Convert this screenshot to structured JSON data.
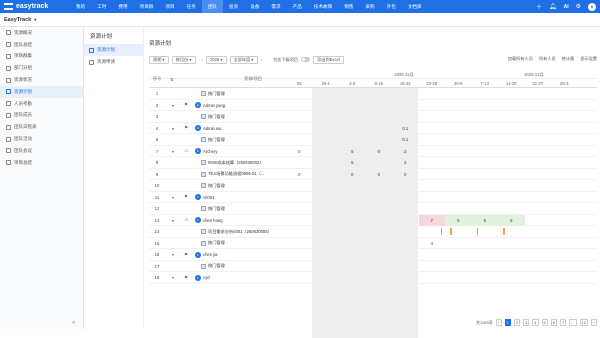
{
  "app": {
    "name": "easytrack"
  },
  "nav": [
    "我的",
    "工时",
    "费用",
    "项目群",
    "项目",
    "任务",
    "团队",
    "投资",
    "设备",
    "需求",
    "产品",
    "技术故障",
    "销售",
    "采购",
    "外包",
    "文档库"
  ],
  "nav_active_index": 6,
  "subbar_title": "EasyTrack",
  "sidebar": [
    {
      "label": "资源概况",
      "active": false
    },
    {
      "label": "团队总结",
      "active": false
    },
    {
      "label": "项目群集",
      "active": false
    },
    {
      "label": "部门分组",
      "active": false
    },
    {
      "label": "资源状况",
      "active": false
    },
    {
      "label": "资源计划",
      "active": true
    },
    {
      "label": "人员考勤",
      "active": false
    },
    {
      "label": "团队成员",
      "active": false
    },
    {
      "label": "团队日程表",
      "active": false
    },
    {
      "label": "团队活动",
      "active": false
    },
    {
      "label": "团队会议",
      "active": false
    },
    {
      "label": "项目总结",
      "active": false
    }
  ],
  "subnav": {
    "heading": "资源计划",
    "items": [
      {
        "label": "资源计划",
        "active": true
      },
      {
        "label": "资源申请",
        "active": false
      }
    ]
  },
  "page_title": "资源计划",
  "toolbar": {
    "unit": "周期",
    "view": "按月份",
    "year": "2025",
    "range": "全部年度",
    "toggle_label": "包含下级项目",
    "export": "导出到Excel",
    "right": [
      "加载所有人员",
      "所有人员",
      "统计量",
      "显示设置"
    ]
  },
  "header": {
    "seq": "序号",
    "name": "资源/项目",
    "months": [
      {
        "label": "2025-11月"
      },
      {
        "label": "2025-12月"
      }
    ],
    "weeks": [
      "25",
      "26-1",
      "2-8",
      "9-15",
      "16-22",
      "23-29",
      "30-6",
      "7-13",
      "14-20",
      "21-27",
      "28-3"
    ]
  },
  "rows": [
    {
      "num": "1",
      "type": "task",
      "name": "按门管理",
      "cells": [
        "",
        "",
        "",
        "",
        "",
        "",
        "",
        "",
        "",
        "",
        ""
      ]
    },
    {
      "num": "2",
      "type": "person",
      "initial": "A",
      "name": "Admin yang",
      "arrow": true,
      "flag": true,
      "cells": [
        "",
        "",
        "",
        "",
        "",
        "",
        "",
        "",
        "",
        "",
        ""
      ]
    },
    {
      "num": "3",
      "type": "task",
      "name": "按门管理",
      "cells": [
        "",
        "",
        "",
        "",
        "",
        "",
        "",
        "",
        "",
        "",
        ""
      ]
    },
    {
      "num": "4",
      "type": "person",
      "initial": "A",
      "name": "Admin wu",
      "arrow": true,
      "flag": true,
      "cells": [
        "",
        "",
        "",
        "",
        "0.1",
        "",
        "",
        "",
        "",
        "",
        ""
      ]
    },
    {
      "num": "6",
      "type": "task",
      "name": "按门管理",
      "cells": [
        "",
        "",
        "",
        "",
        "0.1",
        "",
        "",
        "",
        "",
        "",
        ""
      ]
    },
    {
      "num": "7",
      "type": "person",
      "initial": "A",
      "name": "Archery",
      "arrow": true,
      "warn": true,
      "cells": [
        "0",
        "",
        "5",
        "0",
        "2",
        "",
        "",
        "",
        "",
        "",
        ""
      ]
    },
    {
      "num": "8",
      "type": "task",
      "name": "0530成本核算（250530002）",
      "cells": [
        "",
        "",
        "5",
        "",
        "2",
        "",
        "",
        "",
        "",
        "",
        ""
      ]
    },
    {
      "num": "9",
      "type": "task",
      "name": "TEA场景功能流程0506-01（...",
      "cells": [
        "0",
        "",
        "0",
        "0",
        "0",
        "",
        "",
        "",
        "",
        "",
        ""
      ]
    },
    {
      "num": "10",
      "type": "task",
      "name": "按门管理",
      "cells": [
        "",
        "",
        "",
        "",
        "",
        "",
        "",
        "",
        "",
        "",
        ""
      ]
    },
    {
      "num": "11",
      "type": "person",
      "initial": "c",
      "name": "ch001",
      "arrow": true,
      "flag": true,
      "cells": [
        "",
        "",
        "",
        "",
        "",
        "",
        "",
        "",
        "",
        "",
        ""
      ]
    },
    {
      "num": "12",
      "type": "task",
      "name": "按门管理",
      "cells": [
        "",
        "",
        "",
        "",
        "",
        "",
        "",
        "",
        "",
        "",
        ""
      ]
    },
    {
      "num": "13",
      "type": "person",
      "initial": "c",
      "name": "chen hong",
      "arrow": true,
      "warn": true,
      "cells": [
        "",
        "",
        "",
        "",
        "",
        "7",
        "5",
        "5",
        "5",
        "",
        ""
      ]
    },
    {
      "num": "14",
      "type": "task",
      "name": "项目需求分析0301（250530005）",
      "cells": [
        "",
        "",
        "",
        "",
        "",
        "",
        "",
        "",
        "",
        "",
        ""
      ]
    },
    {
      "num": "15",
      "type": "task",
      "name": "按门管理",
      "cells": [
        "",
        "",
        "",
        "",
        "",
        "4",
        "",
        "",
        "",
        "",
        ""
      ]
    },
    {
      "num": "16",
      "type": "person",
      "initial": "c",
      "name": "chen jia",
      "arrow": true,
      "flag": true,
      "cells": [
        "",
        "",
        "",
        "",
        "",
        "",
        "",
        "",
        "",
        "",
        ""
      ]
    },
    {
      "num": "17",
      "type": "task",
      "name": "按门管理",
      "cells": [
        "",
        "",
        "",
        "",
        "",
        "",
        "",
        "",
        "",
        "",
        ""
      ]
    },
    {
      "num": "18",
      "type": "person",
      "initial": "c",
      "name": "cyd",
      "arrow": true,
      "flag": true,
      "cells": [
        "",
        "",
        "",
        "",
        "",
        "",
        "",
        "",
        "",
        "",
        ""
      ]
    }
  ],
  "pager": {
    "total": "共1153项",
    "pages": [
      "1",
      "2",
      "3",
      "4",
      "5",
      "6",
      "7",
      "...",
      "12"
    ],
    "active": "1",
    "prev": "‹",
    "next": "›"
  },
  "colors": {
    "accent": "#1f6fe5",
    "over": "#f8d7dc",
    "ok": "#dff3dd",
    "bar": "#f0a040"
  },
  "icons": {
    "flag": "flag-icon",
    "warn": "warning-icon"
  }
}
